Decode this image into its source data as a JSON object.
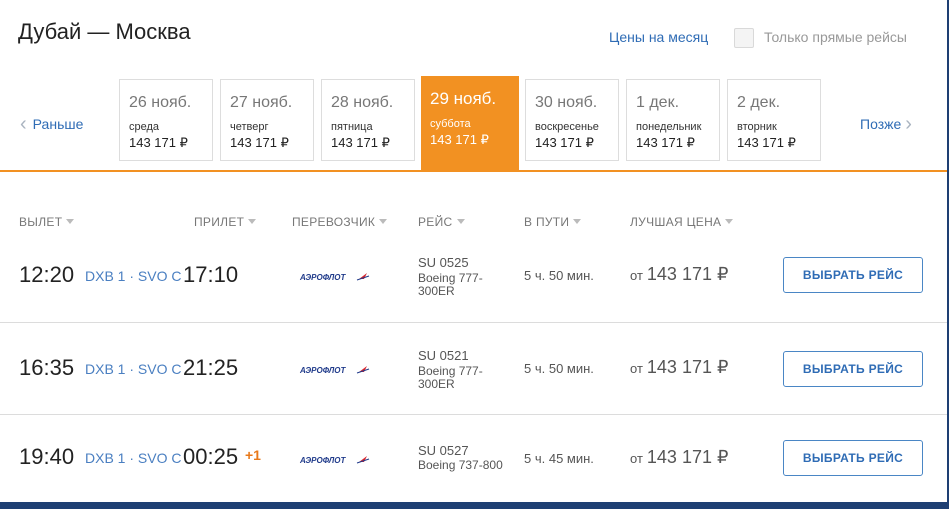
{
  "header": {
    "route_title": "Дубай — Москва",
    "month_prices_link": "Цены на месяц",
    "direct_only_label": "Только прямые рейсы",
    "direct_only_checked": false
  },
  "date_nav": {
    "prev_label": "Раньше",
    "next_label": "Позже",
    "dates": [
      {
        "date": "26 нояб.",
        "weekday": "среда",
        "price": "143 171 ₽",
        "selected": false
      },
      {
        "date": "27 нояб.",
        "weekday": "четверг",
        "price": "143 171 ₽",
        "selected": false
      },
      {
        "date": "28 нояб.",
        "weekday": "пятница",
        "price": "143 171 ₽",
        "selected": false
      },
      {
        "date": "29 нояб.",
        "weekday": "суббота",
        "price": "143 171 ₽",
        "selected": true
      },
      {
        "date": "30 нояб.",
        "weekday": "воскресенье",
        "price": "143 171 ₽",
        "selected": false
      },
      {
        "date": "1 дек.",
        "weekday": "понедельник",
        "price": "143 171 ₽",
        "selected": false
      },
      {
        "date": "2 дек.",
        "weekday": "вторник",
        "price": "143 171 ₽",
        "selected": false
      }
    ]
  },
  "columns": {
    "departure": "ВЫЛЕТ",
    "arrival": "ПРИЛЕТ",
    "carrier": "ПЕРЕВОЗЧИК",
    "flight": "РЕЙС",
    "duration": "В ПУТИ",
    "best_price": "ЛУЧШАЯ ЦЕНА"
  },
  "flights": [
    {
      "dep_time": "12:20",
      "codes": "DXB 1 · SVO C",
      "arr_time": "17:10",
      "next_day": "",
      "carrier_logo": "АЭРОФЛОТ",
      "flight_no": "SU 0525",
      "aircraft": "Boeing 777-300ER",
      "duration": "5 ч. 50 мин.",
      "price_prefix": "от",
      "price": "143 171 ₽",
      "action": "ВЫБРАТЬ РЕЙС"
    },
    {
      "dep_time": "16:35",
      "codes": "DXB 1 · SVO C",
      "arr_time": "21:25",
      "next_day": "",
      "carrier_logo": "АЭРОФЛОТ",
      "flight_no": "SU 0521",
      "aircraft": "Boeing 777-300ER",
      "duration": "5 ч. 50 мин.",
      "price_prefix": "от",
      "price": "143 171 ₽",
      "action": "ВЫБРАТЬ РЕЙС"
    },
    {
      "dep_time": "19:40",
      "codes": "DXB 1 · SVO C",
      "arr_time": "00:25",
      "next_day": "+1",
      "carrier_logo": "АЭРОФЛОТ",
      "flight_no": "SU 0527",
      "aircraft": "Boeing 737-800",
      "duration": "5 ч. 45 мин.",
      "price_prefix": "от",
      "price": "143 171 ₽",
      "action": "ВЫБРАТЬ РЕЙС"
    }
  ],
  "colors": {
    "accent": "#f29122",
    "link": "#2f6cb5",
    "frame": "#1e3f73",
    "aeroflot_blue": "#1f3a8a",
    "aeroflot_red": "#d7262e"
  },
  "icons": {
    "prev": "chevron-left-icon",
    "next": "chevron-right-icon",
    "sort": "sort-caret-icon"
  }
}
